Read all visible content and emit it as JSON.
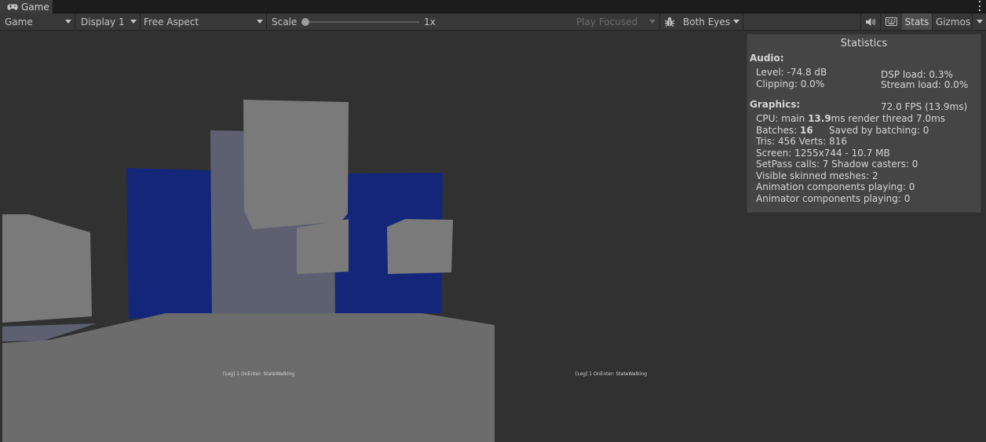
{
  "tab": {
    "icon": "gamepad-icon",
    "label": "Game"
  },
  "toolbar": {
    "mode": "Game",
    "display": "Display 1",
    "aspect": "Free Aspect",
    "scale_label": "Scale",
    "scale_value": "1x",
    "play_mode": "Play Focused",
    "debug_icon": "bug-icon",
    "eyes": "Both Eyes",
    "audio_icon": "speaker-mute-icon",
    "keyboard_icon": "keyboard-icon",
    "stats": "Stats",
    "gizmos": "Gizmos"
  },
  "viewport": {
    "log_left": "[Log] 1 OnEnter: StateWalking",
    "log_right": "[Log] 1 OnEnter: StateWalking",
    "colors": {
      "background": "#313131",
      "blue": "#14267a",
      "gray": "#7a7a7a",
      "slate": "#5d6071",
      "floor": "#6c6c6c"
    }
  },
  "stats": {
    "title": "Statistics",
    "audio_head": "Audio:",
    "level": "Level: -74.8 dB",
    "clipping": "Clipping: 0.0%",
    "dsp": "DSP load: 0.3%",
    "stream": "Stream load: 0.0%",
    "graphics_head": "Graphics:",
    "fps": "72.0 FPS (13.9ms)",
    "cpu_a": "CPU: main ",
    "cpu_main": "13.9",
    "cpu_b": "ms  render thread 7.0ms",
    "batches_a": "Batches: ",
    "batches": "16",
    "saved": "Saved by batching: 0",
    "tris": "Tris: 456   Verts: 816",
    "screen": "Screen: 1255x744 - 10.7 MB",
    "setpass": "SetPass calls: 7  Shadow casters: 0",
    "skinned": "Visible skinned meshes: 2",
    "anim": "Animation components playing: 0",
    "animator": "Animator components playing: 0"
  }
}
